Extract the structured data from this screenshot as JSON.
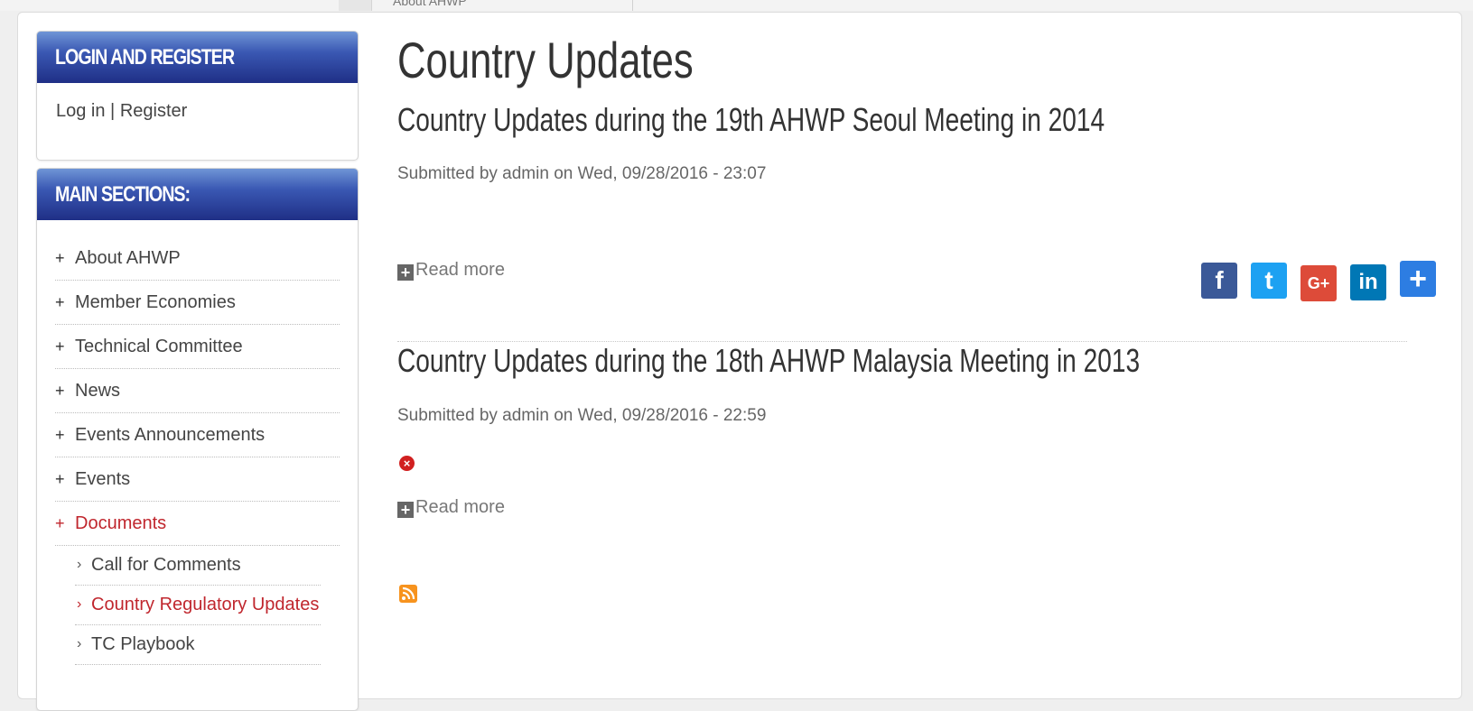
{
  "topstrip": {
    "ghost_text": "About AHWP"
  },
  "sidebar": {
    "login_block": {
      "title": "LOGIN AND REGISTER",
      "login_link": "Log in",
      "separator": " | ",
      "register_link": "Register"
    },
    "main_block": {
      "title": "MAIN SECTIONS:",
      "items": [
        {
          "label": "About AHWP"
        },
        {
          "label": "Member Economies"
        },
        {
          "label": "Technical Committee"
        },
        {
          "label": "News"
        },
        {
          "label": "Events Announcements"
        },
        {
          "label": "Events"
        },
        {
          "label": "Documents"
        }
      ],
      "subitems": [
        {
          "label": "Call for Comments"
        },
        {
          "label": "Country Regulatory Updates"
        },
        {
          "label": "TC Playbook"
        }
      ],
      "plus_glyph": "+",
      "chev_glyph": "›"
    }
  },
  "content": {
    "page_title": "Country Updates",
    "nodes": [
      {
        "title": "Country Updates during the 19th AHWP Seoul Meeting in 2014",
        "submitted": "Submitted by admin on Wed, 09/28/2016 - 23:07",
        "read_more": "Read more"
      },
      {
        "title": "Country Updates during the 18th AHWP Malaysia Meeting in 2013",
        "submitted": "Submitted by admin on Wed, 09/28/2016 - 22:59",
        "read_more": "Read more"
      }
    ],
    "share": {
      "facebook": "f",
      "twitter": "t",
      "google": "G+",
      "linkedin": "in",
      "more": "+"
    }
  }
}
